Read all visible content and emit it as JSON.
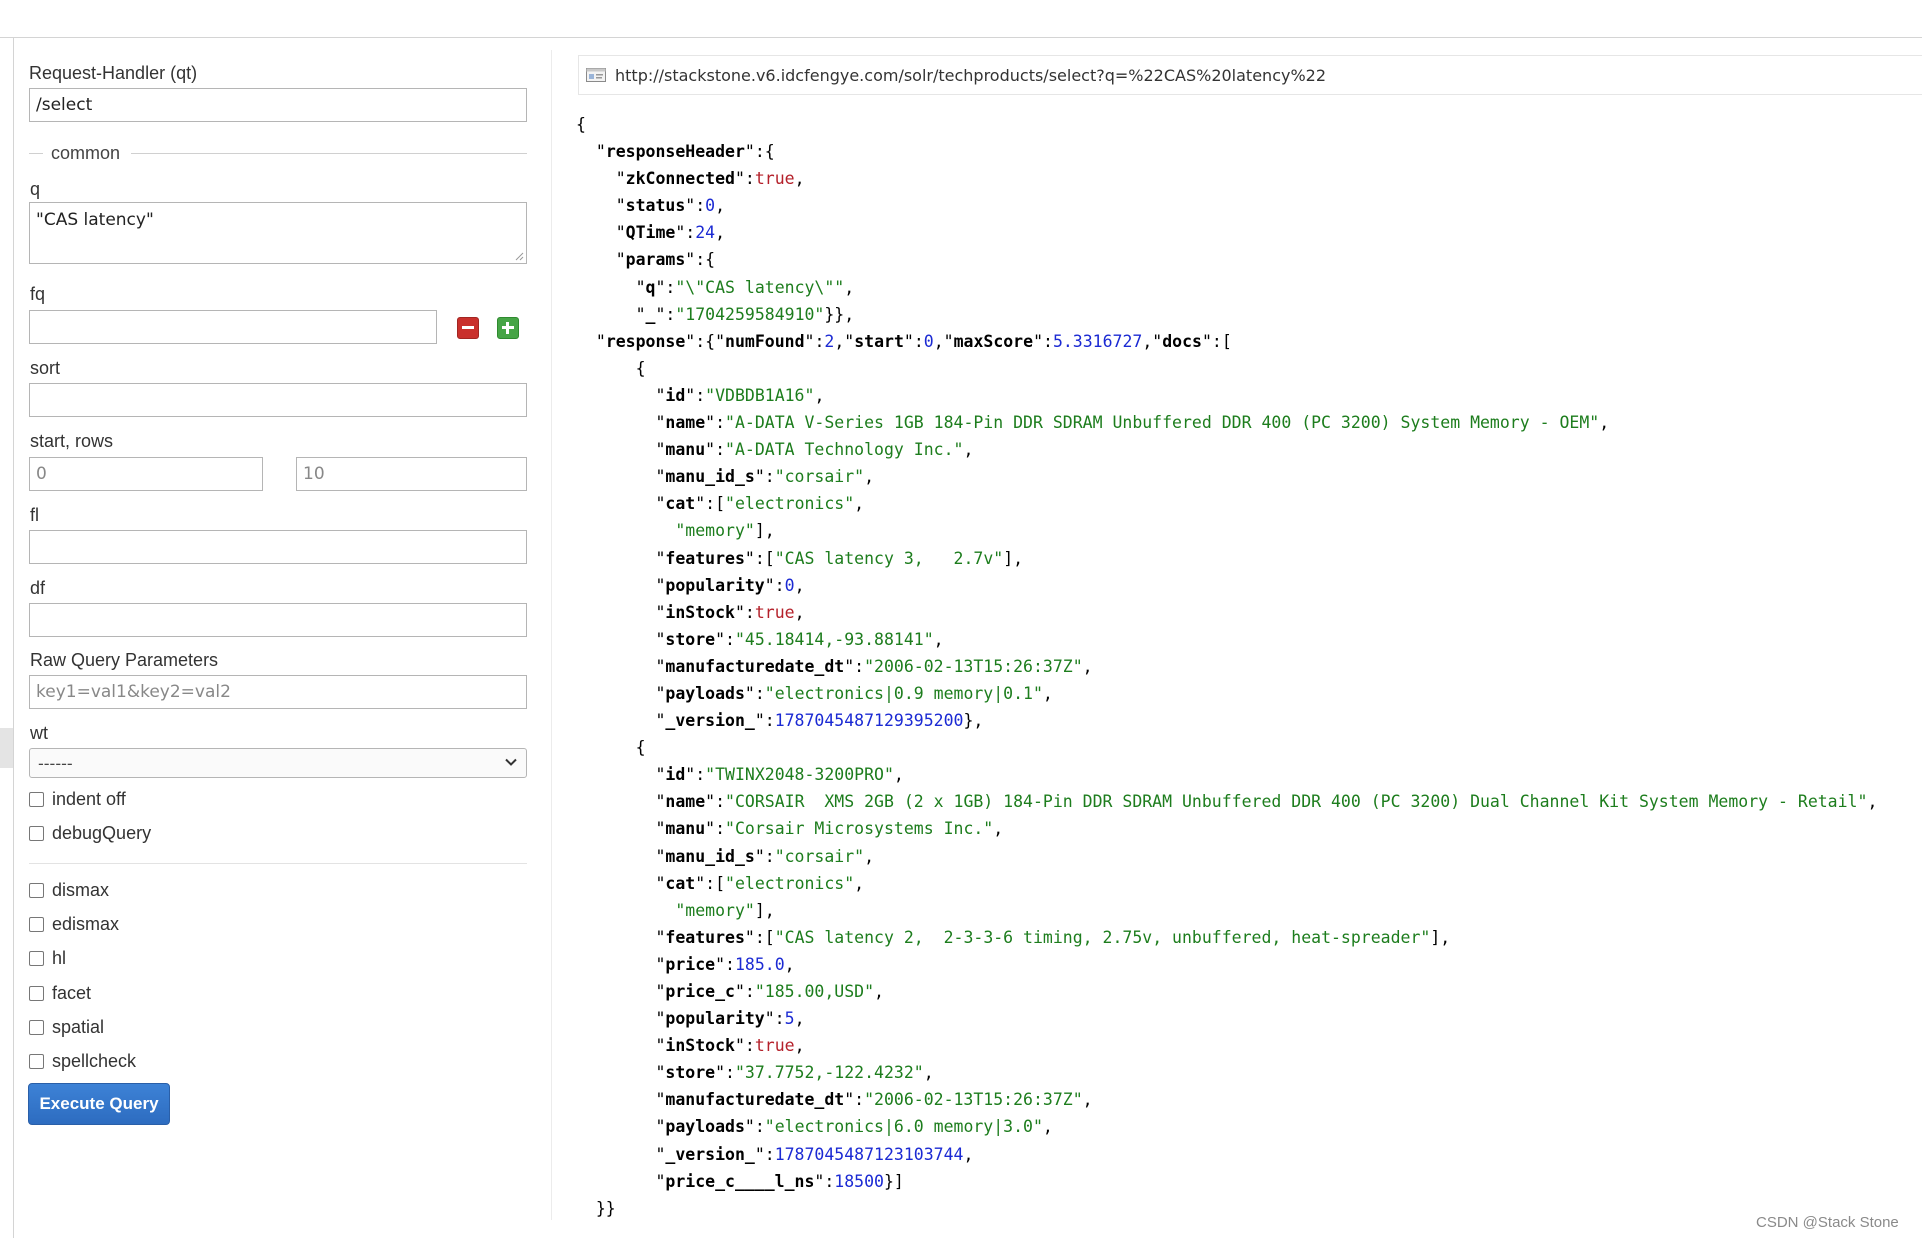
{
  "form": {
    "request_handler_label": "Request-Handler (qt)",
    "request_handler_value": "/select",
    "common_legend": "common",
    "q_label": "q",
    "q_value": "\"CAS latency\"",
    "fq_label": "fq",
    "fq_value": "",
    "sort_label": "sort",
    "sort_value": "",
    "start_rows_label": "start, rows",
    "start_placeholder": "0",
    "rows_placeholder": "10",
    "fl_label": "fl",
    "fl_value": "",
    "df_label": "df",
    "df_value": "",
    "raw_label": "Raw Query Parameters",
    "raw_placeholder": "key1=val1&key2=val2",
    "wt_label": "wt",
    "wt_value": "------",
    "checkboxes_a": [
      "indent off",
      "debugQuery"
    ],
    "checkboxes_b": [
      "dismax",
      "edismax",
      "hl",
      "facet",
      "spatial",
      "spellcheck"
    ],
    "execute_label": "Execute Query"
  },
  "result": {
    "url": "http://stackstone.v6.idcfengye.com/solr/techproducts/select?q=%22CAS%20latency%22",
    "lines": [
      [
        [
          "p",
          "{"
        ]
      ],
      [
        [
          "p",
          "  \""
        ],
        [
          "k",
          "responseHeader"
        ],
        [
          "p",
          "\":{"
        ]
      ],
      [
        [
          "p",
          "    \""
        ],
        [
          "k",
          "zkConnected"
        ],
        [
          "p",
          "\":"
        ],
        [
          "b",
          "true"
        ],
        [
          "p",
          ","
        ]
      ],
      [
        [
          "p",
          "    \""
        ],
        [
          "k",
          "status"
        ],
        [
          "p",
          "\":"
        ],
        [
          "n",
          "0"
        ],
        [
          "p",
          ","
        ]
      ],
      [
        [
          "p",
          "    \""
        ],
        [
          "k",
          "QTime"
        ],
        [
          "p",
          "\":"
        ],
        [
          "n",
          "24"
        ],
        [
          "p",
          ","
        ]
      ],
      [
        [
          "p",
          "    \""
        ],
        [
          "k",
          "params"
        ],
        [
          "p",
          "\":{"
        ]
      ],
      [
        [
          "p",
          "      \""
        ],
        [
          "k",
          "q"
        ],
        [
          "p",
          "\":"
        ],
        [
          "s",
          "\"\\\"CAS latency\\\"\""
        ],
        [
          "p",
          ","
        ]
      ],
      [
        [
          "p",
          "      \""
        ],
        [
          "k",
          "_"
        ],
        [
          "p",
          "\":"
        ],
        [
          "s",
          "\"1704259584910\""
        ],
        [
          "p",
          "}},"
        ]
      ],
      [
        [
          "p",
          "  \""
        ],
        [
          "k",
          "response"
        ],
        [
          "p",
          "\":{\""
        ],
        [
          "k",
          "numFound"
        ],
        [
          "p",
          "\":"
        ],
        [
          "n",
          "2"
        ],
        [
          "p",
          ",\""
        ],
        [
          "k",
          "start"
        ],
        [
          "p",
          "\":"
        ],
        [
          "n",
          "0"
        ],
        [
          "p",
          ",\""
        ],
        [
          "k",
          "maxScore"
        ],
        [
          "p",
          "\":"
        ],
        [
          "n",
          "5.3316727"
        ],
        [
          "p",
          ",\""
        ],
        [
          "k",
          "docs"
        ],
        [
          "p",
          "\":["
        ]
      ],
      [
        [
          "p",
          "      {"
        ]
      ],
      [
        [
          "p",
          "        \""
        ],
        [
          "k",
          "id"
        ],
        [
          "p",
          "\":"
        ],
        [
          "s",
          "\"VDBDB1A16\""
        ],
        [
          "p",
          ","
        ]
      ],
      [
        [
          "p",
          "        \""
        ],
        [
          "k",
          "name"
        ],
        [
          "p",
          "\":"
        ],
        [
          "s",
          "\"A-DATA V-Series 1GB 184-Pin DDR SDRAM Unbuffered DDR 400 (PC 3200) System Memory - OEM\""
        ],
        [
          "p",
          ","
        ]
      ],
      [
        [
          "p",
          "        \""
        ],
        [
          "k",
          "manu"
        ],
        [
          "p",
          "\":"
        ],
        [
          "s",
          "\"A-DATA Technology Inc.\""
        ],
        [
          "p",
          ","
        ]
      ],
      [
        [
          "p",
          "        \""
        ],
        [
          "k",
          "manu_id_s"
        ],
        [
          "p",
          "\":"
        ],
        [
          "s",
          "\"corsair\""
        ],
        [
          "p",
          ","
        ]
      ],
      [
        [
          "p",
          "        \""
        ],
        [
          "k",
          "cat"
        ],
        [
          "p",
          "\":["
        ],
        [
          "s",
          "\"electronics\""
        ],
        [
          "p",
          ","
        ]
      ],
      [
        [
          "p",
          "          "
        ],
        [
          "s",
          "\"memory\""
        ],
        [
          "p",
          "],"
        ]
      ],
      [
        [
          "p",
          "        \""
        ],
        [
          "k",
          "features"
        ],
        [
          "p",
          "\":["
        ],
        [
          "s",
          "\"CAS latency 3,   2.7v\""
        ],
        [
          "p",
          "],"
        ]
      ],
      [
        [
          "p",
          "        \""
        ],
        [
          "k",
          "popularity"
        ],
        [
          "p",
          "\":"
        ],
        [
          "n",
          "0"
        ],
        [
          "p",
          ","
        ]
      ],
      [
        [
          "p",
          "        \""
        ],
        [
          "k",
          "inStock"
        ],
        [
          "p",
          "\":"
        ],
        [
          "b",
          "true"
        ],
        [
          "p",
          ","
        ]
      ],
      [
        [
          "p",
          "        \""
        ],
        [
          "k",
          "store"
        ],
        [
          "p",
          "\":"
        ],
        [
          "s",
          "\"45.18414,-93.88141\""
        ],
        [
          "p",
          ","
        ]
      ],
      [
        [
          "p",
          "        \""
        ],
        [
          "k",
          "manufacturedate_dt"
        ],
        [
          "p",
          "\":"
        ],
        [
          "s",
          "\"2006-02-13T15:26:37Z\""
        ],
        [
          "p",
          ","
        ]
      ],
      [
        [
          "p",
          "        \""
        ],
        [
          "k",
          "payloads"
        ],
        [
          "p",
          "\":"
        ],
        [
          "s",
          "\"electronics|0.9 memory|0.1\""
        ],
        [
          "p",
          ","
        ]
      ],
      [
        [
          "p",
          "        \""
        ],
        [
          "k",
          "_version_"
        ],
        [
          "p",
          "\":"
        ],
        [
          "n",
          "1787045487129395200"
        ],
        [
          "p",
          "},"
        ]
      ],
      [
        [
          "p",
          "      {"
        ]
      ],
      [
        [
          "p",
          "        \""
        ],
        [
          "k",
          "id"
        ],
        [
          "p",
          "\":"
        ],
        [
          "s",
          "\"TWINX2048-3200PRO\""
        ],
        [
          "p",
          ","
        ]
      ],
      [
        [
          "p",
          "        \""
        ],
        [
          "k",
          "name"
        ],
        [
          "p",
          "\":"
        ],
        [
          "s",
          "\"CORSAIR  XMS 2GB (2 x 1GB) 184-Pin DDR SDRAM Unbuffered DDR 400 (PC 3200) Dual Channel Kit System Memory - Retail\""
        ],
        [
          "p",
          ","
        ]
      ],
      [
        [
          "p",
          "        \""
        ],
        [
          "k",
          "manu"
        ],
        [
          "p",
          "\":"
        ],
        [
          "s",
          "\"Corsair Microsystems Inc.\""
        ],
        [
          "p",
          ","
        ]
      ],
      [
        [
          "p",
          "        \""
        ],
        [
          "k",
          "manu_id_s"
        ],
        [
          "p",
          "\":"
        ],
        [
          "s",
          "\"corsair\""
        ],
        [
          "p",
          ","
        ]
      ],
      [
        [
          "p",
          "        \""
        ],
        [
          "k",
          "cat"
        ],
        [
          "p",
          "\":["
        ],
        [
          "s",
          "\"electronics\""
        ],
        [
          "p",
          ","
        ]
      ],
      [
        [
          "p",
          "          "
        ],
        [
          "s",
          "\"memory\""
        ],
        [
          "p",
          "],"
        ]
      ],
      [
        [
          "p",
          "        \""
        ],
        [
          "k",
          "features"
        ],
        [
          "p",
          "\":["
        ],
        [
          "s",
          "\"CAS latency 2,  2-3-3-6 timing, 2.75v, unbuffered, heat-spreader\""
        ],
        [
          "p",
          "],"
        ]
      ],
      [
        [
          "p",
          "        \""
        ],
        [
          "k",
          "price"
        ],
        [
          "p",
          "\":"
        ],
        [
          "n",
          "185.0"
        ],
        [
          "p",
          ","
        ]
      ],
      [
        [
          "p",
          "        \""
        ],
        [
          "k",
          "price_c"
        ],
        [
          "p",
          "\":"
        ],
        [
          "s",
          "\"185.00,USD\""
        ],
        [
          "p",
          ","
        ]
      ],
      [
        [
          "p",
          "        \""
        ],
        [
          "k",
          "popularity"
        ],
        [
          "p",
          "\":"
        ],
        [
          "n",
          "5"
        ],
        [
          "p",
          ","
        ]
      ],
      [
        [
          "p",
          "        \""
        ],
        [
          "k",
          "inStock"
        ],
        [
          "p",
          "\":"
        ],
        [
          "b",
          "true"
        ],
        [
          "p",
          ","
        ]
      ],
      [
        [
          "p",
          "        \""
        ],
        [
          "k",
          "store"
        ],
        [
          "p",
          "\":"
        ],
        [
          "s",
          "\"37.7752,-122.4232\""
        ],
        [
          "p",
          ","
        ]
      ],
      [
        [
          "p",
          "        \""
        ],
        [
          "k",
          "manufacturedate_dt"
        ],
        [
          "p",
          "\":"
        ],
        [
          "s",
          "\"2006-02-13T15:26:37Z\""
        ],
        [
          "p",
          ","
        ]
      ],
      [
        [
          "p",
          "        \""
        ],
        [
          "k",
          "payloads"
        ],
        [
          "p",
          "\":"
        ],
        [
          "s",
          "\"electronics|6.0 memory|3.0\""
        ],
        [
          "p",
          ","
        ]
      ],
      [
        [
          "p",
          "        \""
        ],
        [
          "k",
          "_version_"
        ],
        [
          "p",
          "\":"
        ],
        [
          "n",
          "1787045487123103744"
        ],
        [
          "p",
          ","
        ]
      ],
      [
        [
          "p",
          "        \""
        ],
        [
          "k",
          "price_c____l_ns"
        ],
        [
          "p",
          "\":"
        ],
        [
          "n",
          "18500"
        ],
        [
          "p",
          "}]"
        ]
      ],
      [
        [
          "p",
          "  }}"
        ]
      ]
    ]
  },
  "watermark": "CSDN @Stack Stone",
  "colors": {
    "json_key": "#000000",
    "json_string": "#1d7d1d",
    "json_number": "#1b2ad3",
    "json_boolean": "#b4202a",
    "execute_button": "#2d6cc0"
  }
}
